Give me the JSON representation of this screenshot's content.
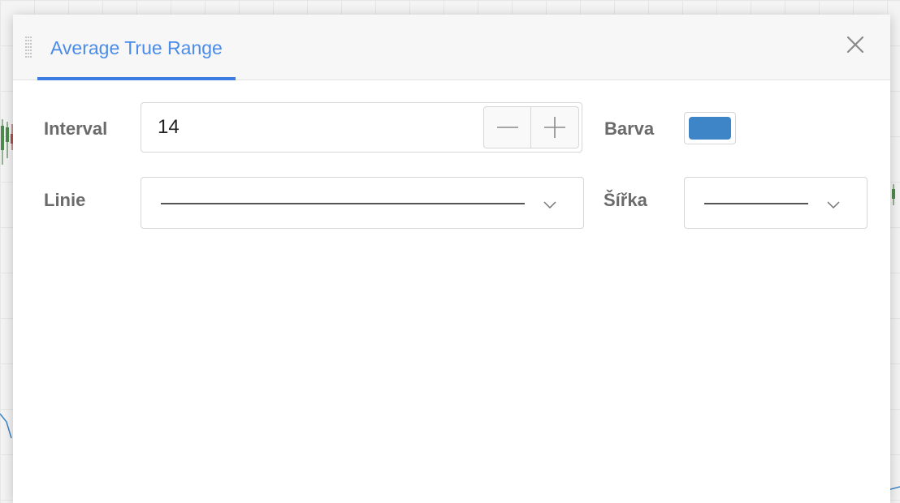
{
  "dialog": {
    "title": "Average True Range",
    "close_icon": "close-icon",
    "drag_icon": "drag-handle-icon"
  },
  "fields": {
    "interval": {
      "label": "Interval",
      "value": "14",
      "decrement_icon": "minus-icon",
      "increment_icon": "plus-icon"
    },
    "color": {
      "label": "Barva",
      "value": "#3d85c6"
    },
    "line": {
      "label": "Linie",
      "style": "solid",
      "chevron_icon": "chevron-down-icon"
    },
    "width": {
      "label": "Šířka",
      "chevron_icon": "chevron-down-icon"
    }
  },
  "colors": {
    "accent": "#3b7de0",
    "title": "#4a8ce8",
    "label": "#6a6a6a",
    "swatch": "#3d85c6"
  }
}
